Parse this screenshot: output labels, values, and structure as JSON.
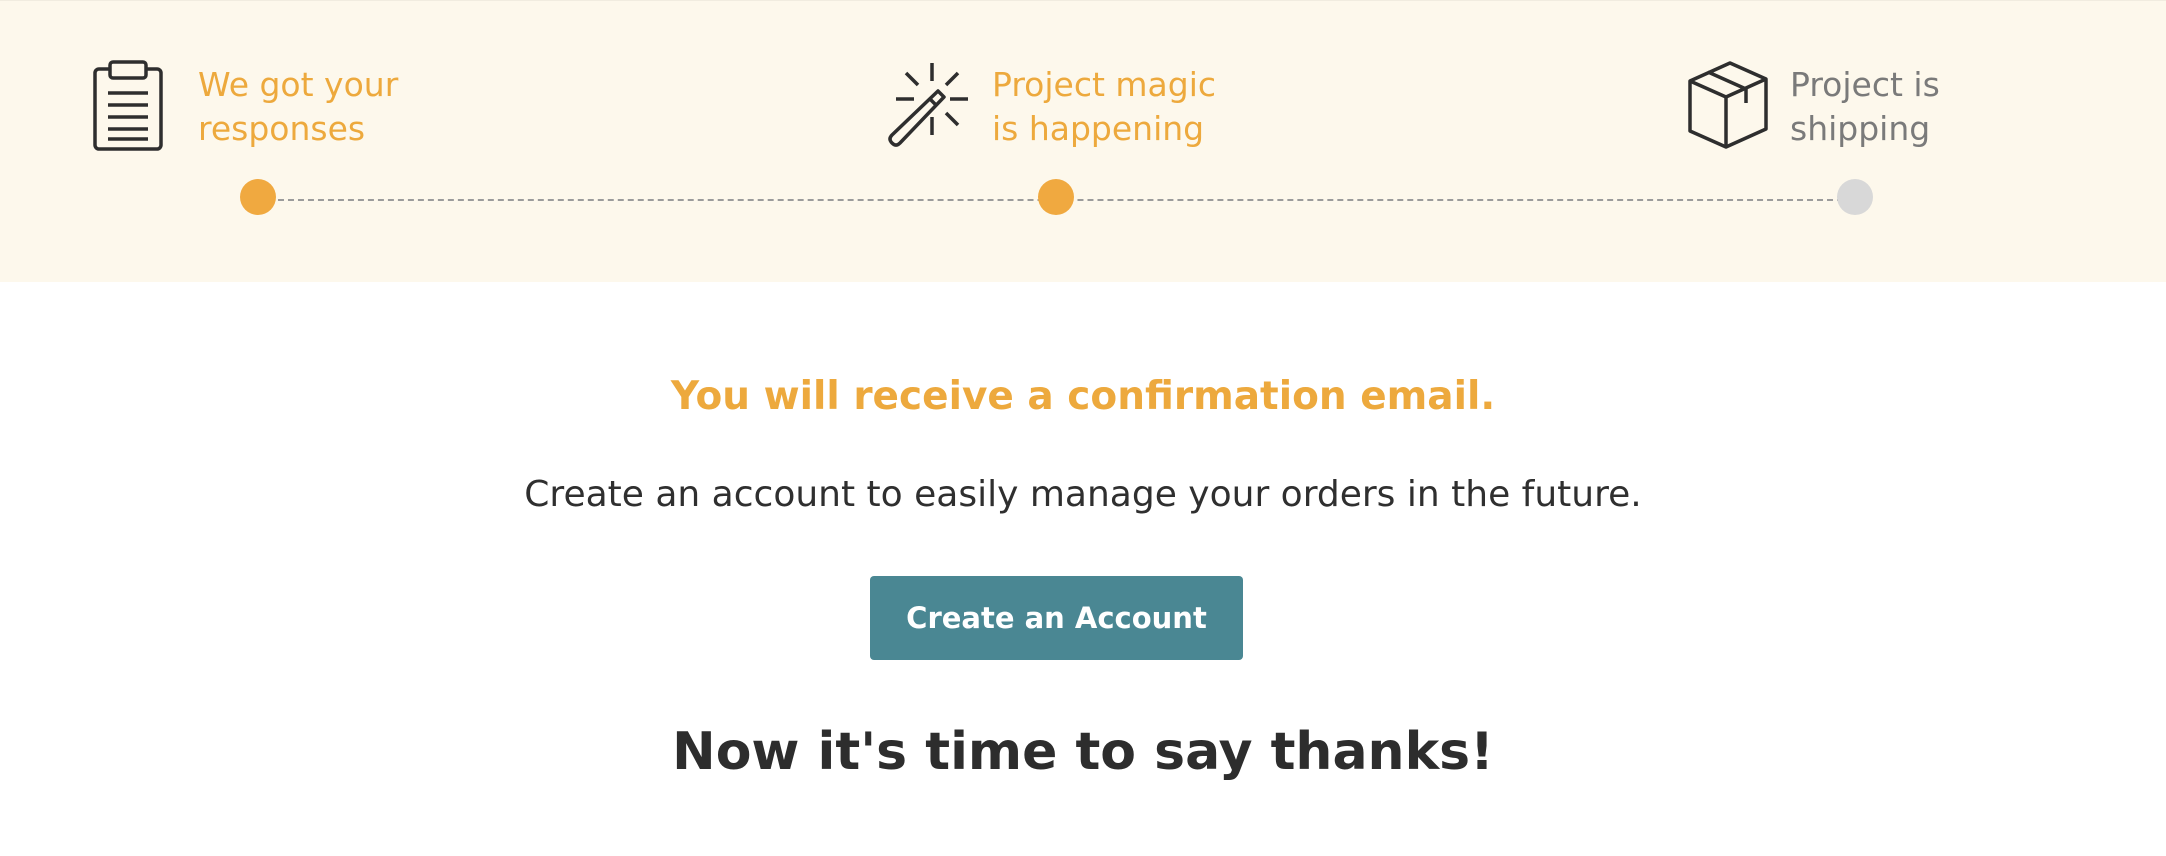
{
  "progress": {
    "steps": [
      {
        "line1": "We got your",
        "line2": "responses",
        "icon": "clipboard-icon",
        "state": "complete"
      },
      {
        "line1": "Project magic",
        "line2": "is happening",
        "icon": "magic-wand-icon",
        "state": "complete"
      },
      {
        "line1": "Project is",
        "line2": "shipping",
        "icon": "box-icon",
        "state": "pending"
      }
    ],
    "completed_steps": 2,
    "total_steps": 3
  },
  "main": {
    "confirmation": "You will receive a confirmation email.",
    "subtext": "Create an account to easily manage your orders in the future.",
    "cta_label": "Create an Account",
    "thanks": "Now it's time to say thanks!"
  },
  "colors": {
    "accent": "#eda93d",
    "band_background": "#fdf8ec",
    "button": "#4a8793",
    "inactive_dot": "#d8d8d8",
    "inactive_text": "#7a7a7a"
  }
}
